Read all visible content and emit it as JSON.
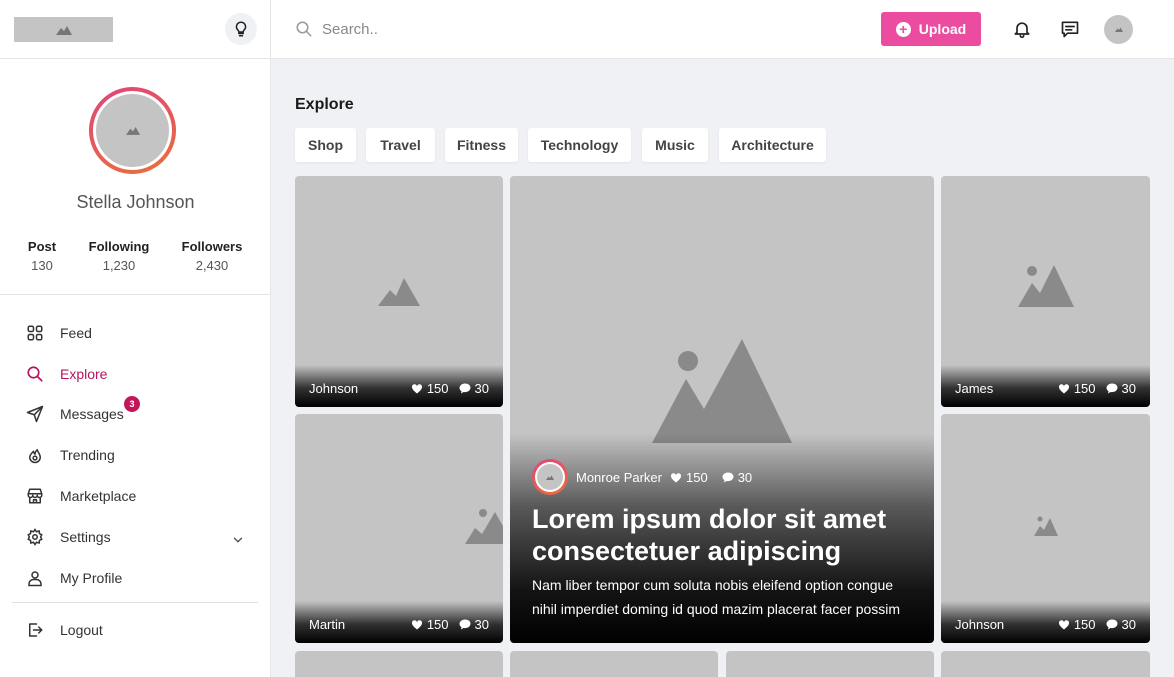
{
  "header": {
    "search_placeholder": "Search..",
    "upload_label": "Upload",
    "upload_color": "#ec4ca0"
  },
  "profile": {
    "name": "Stella Johnson",
    "stats": [
      {
        "label": "Post",
        "value": "130"
      },
      {
        "label": "Following",
        "value": "1,230"
      },
      {
        "label": "Followers",
        "value": "2,430"
      }
    ]
  },
  "sidebar": {
    "accent_color": "#b8145e",
    "items": [
      {
        "label": "Feed",
        "icon": "grid-icon"
      },
      {
        "label": "Explore",
        "icon": "search-icon",
        "active": true
      },
      {
        "label": "Messages",
        "icon": "send-icon",
        "badge": "3"
      },
      {
        "label": "Trending",
        "icon": "fire-icon"
      },
      {
        "label": "Marketplace",
        "icon": "store-icon"
      },
      {
        "label": "Settings",
        "icon": "gear-icon"
      },
      {
        "label": "My Profile",
        "icon": "user-icon"
      }
    ],
    "logout_label": "Logout"
  },
  "explore": {
    "title": "Explore",
    "categories": [
      "Shop",
      "Travel",
      "Fitness",
      "Technology",
      "Music",
      "Architecture"
    ]
  },
  "cards": [
    {
      "name": "Johnson",
      "likes": "150",
      "comments": "30"
    },
    {
      "name": "Martin",
      "likes": "150",
      "comments": "30"
    },
    {
      "name": "James",
      "likes": "150",
      "comments": "30"
    },
    {
      "name": "Johnson",
      "likes": "150",
      "comments": "30"
    }
  ],
  "featured": {
    "author": "Monroe Parker",
    "likes": "150",
    "comments": "30",
    "title": "Lorem ipsum dolor sit amet consectetuer adipiscing",
    "description": "Nam liber tempor cum soluta nobis eleifend option congue nihil imperdiet doming id quod mazim placerat facer possim"
  }
}
